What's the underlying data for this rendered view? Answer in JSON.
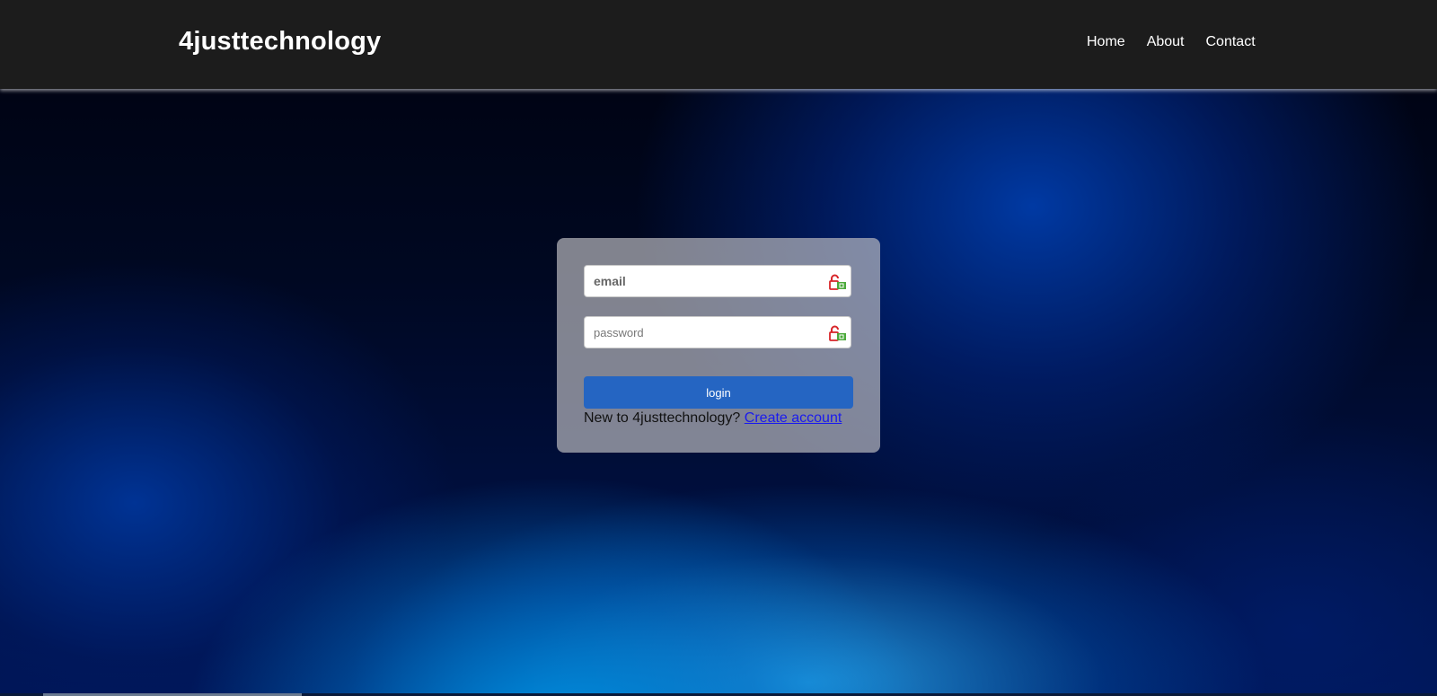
{
  "header": {
    "brand": "4justtechnology",
    "nav": [
      {
        "label": "Home"
      },
      {
        "label": "About"
      },
      {
        "label": "Contact"
      }
    ]
  },
  "login_form": {
    "email_placeholder": "email",
    "password_placeholder": "password",
    "login_label": "login",
    "signup_prompt": "New to 4justtechnology?",
    "signup_link": "Create account"
  },
  "icons": {
    "field_icon": "lock-icon"
  },
  "colors": {
    "navbar": "#1c1c1c",
    "button": "#2565c2",
    "link": "#1a1aee"
  }
}
